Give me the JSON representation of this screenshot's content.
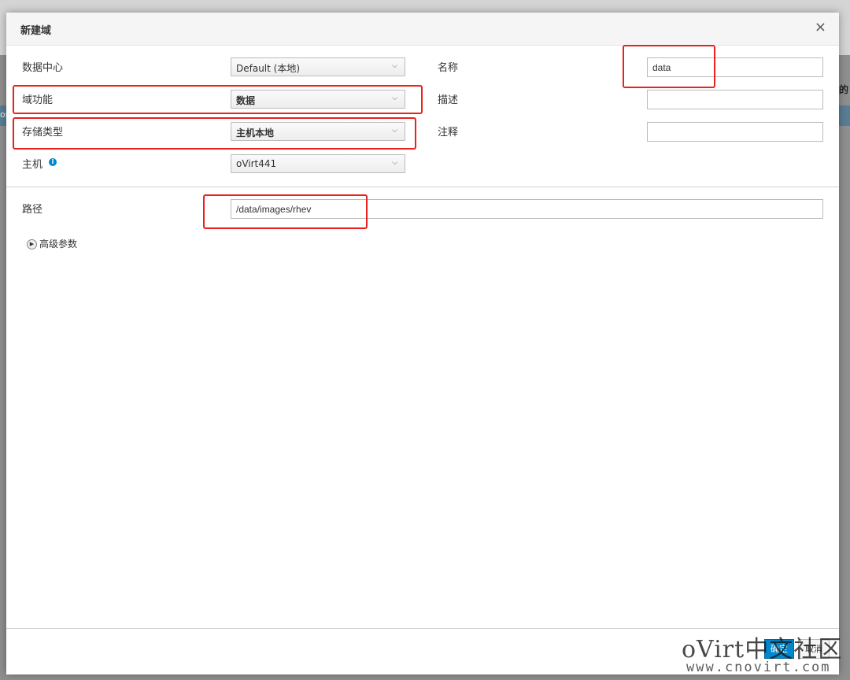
{
  "background": {
    "right_fragment": "的",
    "left_fragment": "os",
    "band_right_fragment": "]"
  },
  "dialog": {
    "title": "新建域",
    "close_glyph": "×"
  },
  "form": {
    "datacenter": {
      "label": "数据中心",
      "value": "Default (本地)"
    },
    "domain_function": {
      "label": "域功能",
      "value": "数据"
    },
    "storage_type": {
      "label": "存储类型",
      "value": "主机本地"
    },
    "host": {
      "label": "主机",
      "value": "oVirt441",
      "info_icon": "info-icon"
    },
    "name": {
      "label": "名称",
      "value": "data"
    },
    "description": {
      "label": "描述",
      "value": ""
    },
    "comment": {
      "label": "注释",
      "value": ""
    },
    "path": {
      "label": "路径",
      "value": "/data/images/rhev"
    },
    "advanced": {
      "label": "高级参数"
    }
  },
  "footer": {
    "ok_label": "确定",
    "cancel_label": "取消"
  },
  "watermark": {
    "line1": "oVirt中文社区",
    "line2": "www.cnovirt.com"
  },
  "colors": {
    "highlight": "#e8221c",
    "primary": "#0088ce"
  }
}
